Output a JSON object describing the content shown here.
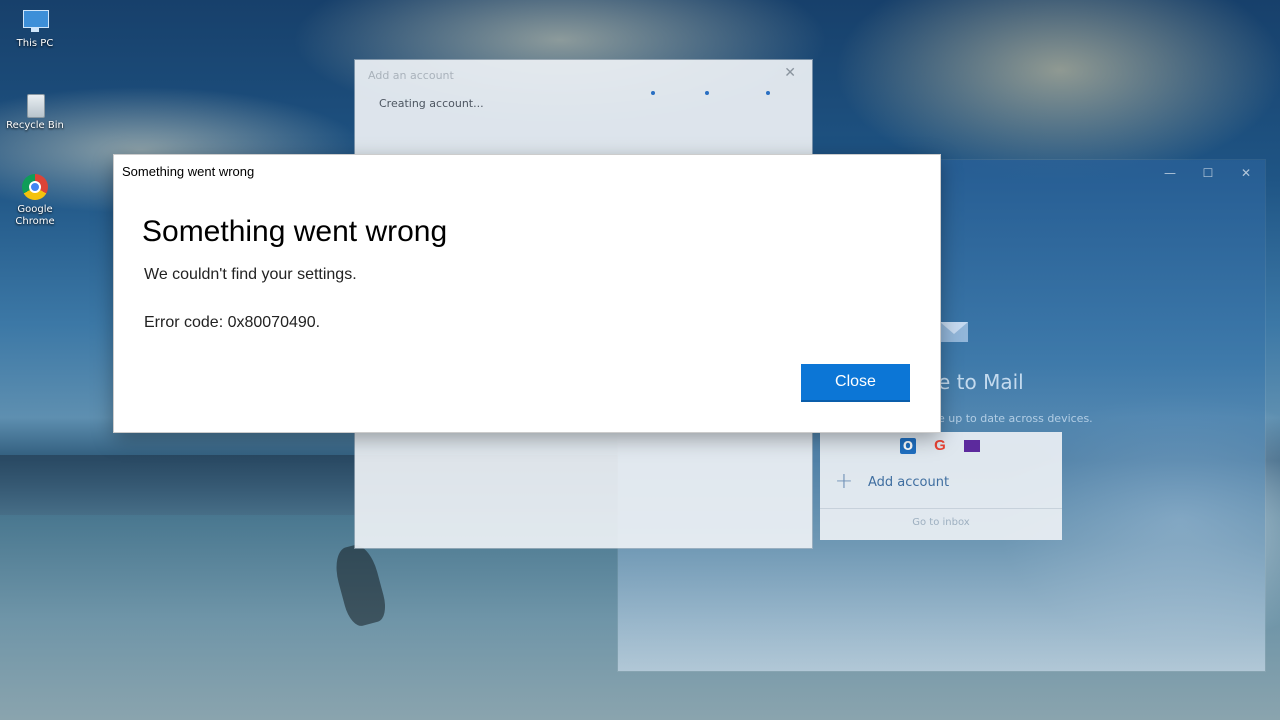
{
  "desktop": {
    "icons": [
      {
        "label": "This PC",
        "icon": "this-pc-icon"
      },
      {
        "label": "Recycle Bin",
        "icon": "recycle-bin-icon"
      },
      {
        "label": "Google Chrome",
        "icon": "chrome-icon"
      }
    ]
  },
  "mail_window": {
    "controls": {
      "minimize": "—",
      "maximize": "☐",
      "close": "✕"
    },
    "welcome_text": "e to Mail",
    "subtitle_text": "e up to date across devices.",
    "account_icons": [
      "outlook-icon",
      "google-icon",
      "yahoo-mail-icon"
    ],
    "google_glyph": "G",
    "outlook_glyph": "O",
    "add_account_label": "Add account",
    "go_to_inbox_label": "Go to inbox"
  },
  "add_account_window": {
    "title": "Add an account",
    "status": "Creating account...",
    "close_glyph": "✕"
  },
  "dialog": {
    "title": "Something went wrong",
    "heading": "Something went wrong",
    "message": "We couldn't find your settings.",
    "error_code": "Error code: 0x80070490.",
    "close_button_label": "Close",
    "accent_color": "#0c76d6"
  }
}
